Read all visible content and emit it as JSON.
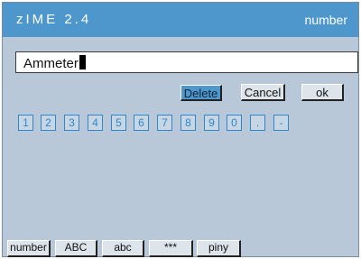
{
  "title": {
    "app": "zIME 2.4",
    "mode": "number"
  },
  "input": {
    "value": "Ammeter"
  },
  "actions": {
    "delete": "Delete",
    "cancel": "Cancel",
    "ok": "ok"
  },
  "keys": [
    "1",
    "2",
    "3",
    "4",
    "5",
    "6",
    "7",
    "8",
    "9",
    "0",
    ".",
    "-"
  ],
  "tabs": [
    "number",
    "ABC",
    "abc",
    "***",
    "piny"
  ],
  "colors": {
    "accent": "#4d97cc",
    "panel": "#b8c8d8",
    "key_text": "#2f86c9"
  }
}
